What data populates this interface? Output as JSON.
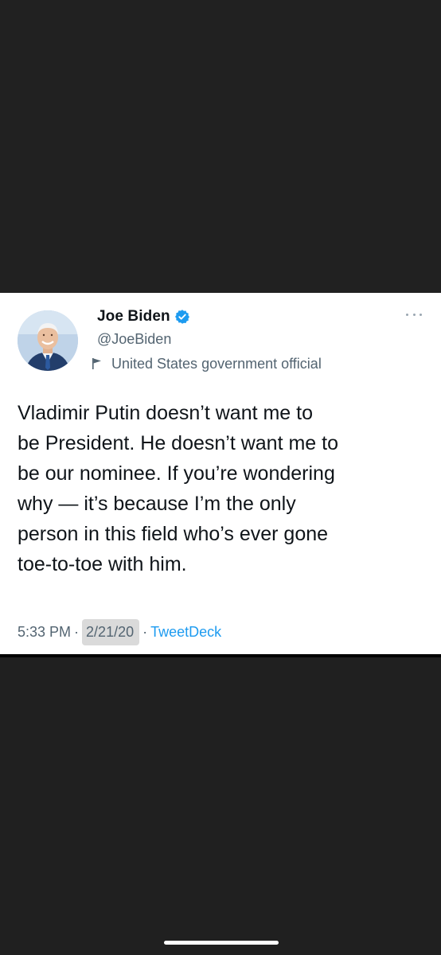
{
  "tweet": {
    "author": {
      "display_name": "Joe Biden",
      "handle": "@JoeBiden",
      "verified": true,
      "affiliation_label": "United States government official"
    },
    "text": "Vladimir Putin doesn’t want me to\nbe President. He doesn’t want me to\nbe our nominee. If you’re wondering\nwhy — it’s because I’m the only\nperson in this field who’s ever gone\ntoe-to-toe with him.",
    "time": "5:33 PM",
    "separator": "·",
    "date": "2/21/20",
    "source": "TweetDeck"
  },
  "icons": {
    "verified": "verified-badge-icon",
    "flag": "flag-icon",
    "more": "more-options-icon"
  },
  "colors": {
    "background": "#212121",
    "card": "#ffffff",
    "primary_text": "#0f1419",
    "secondary_text": "#536471",
    "accent": "#1d9bf0"
  }
}
